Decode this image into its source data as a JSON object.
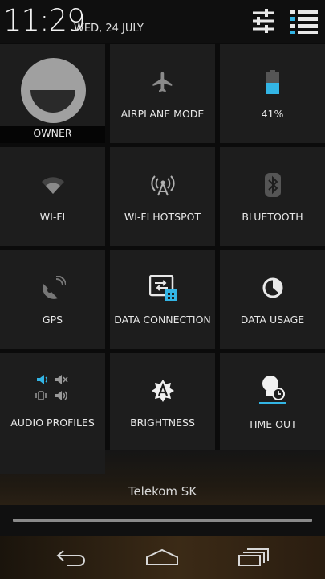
{
  "status": {
    "time": "11:29",
    "date": "WED, 24 JULY"
  },
  "header_icons": [
    "settings-sliders-icon",
    "notifications-list-icon"
  ],
  "tiles": [
    {
      "label": "OWNER",
      "icon": "avatar-icon"
    },
    {
      "label": "AIRPLANE MODE",
      "icon": "airplane-icon"
    },
    {
      "label": "41%",
      "icon": "battery-icon",
      "battery_level": 0.41
    },
    {
      "label": "WI-FI",
      "icon": "wifi-icon"
    },
    {
      "label": "WI-FI HOTSPOT",
      "icon": "hotspot-icon"
    },
    {
      "label": "BLUETOOTH",
      "icon": "bluetooth-icon"
    },
    {
      "label": "GPS",
      "icon": "gps-icon"
    },
    {
      "label": "DATA CONNECTION",
      "icon": "data-connection-icon"
    },
    {
      "label": "DATA USAGE",
      "icon": "data-usage-icon"
    },
    {
      "label": "AUDIO PROFILES",
      "icon": "audio-profiles-icon"
    },
    {
      "label": "BRIGHTNESS",
      "icon": "brightness-auto-icon"
    },
    {
      "label": "TIME OUT",
      "icon": "timeout-icon"
    }
  ],
  "carrier": "Telekom SK",
  "nav": [
    "back-icon",
    "home-icon",
    "recents-icon"
  ],
  "colors": {
    "accent": "#33b5e5",
    "tile_bg": "#1d1d1d"
  }
}
